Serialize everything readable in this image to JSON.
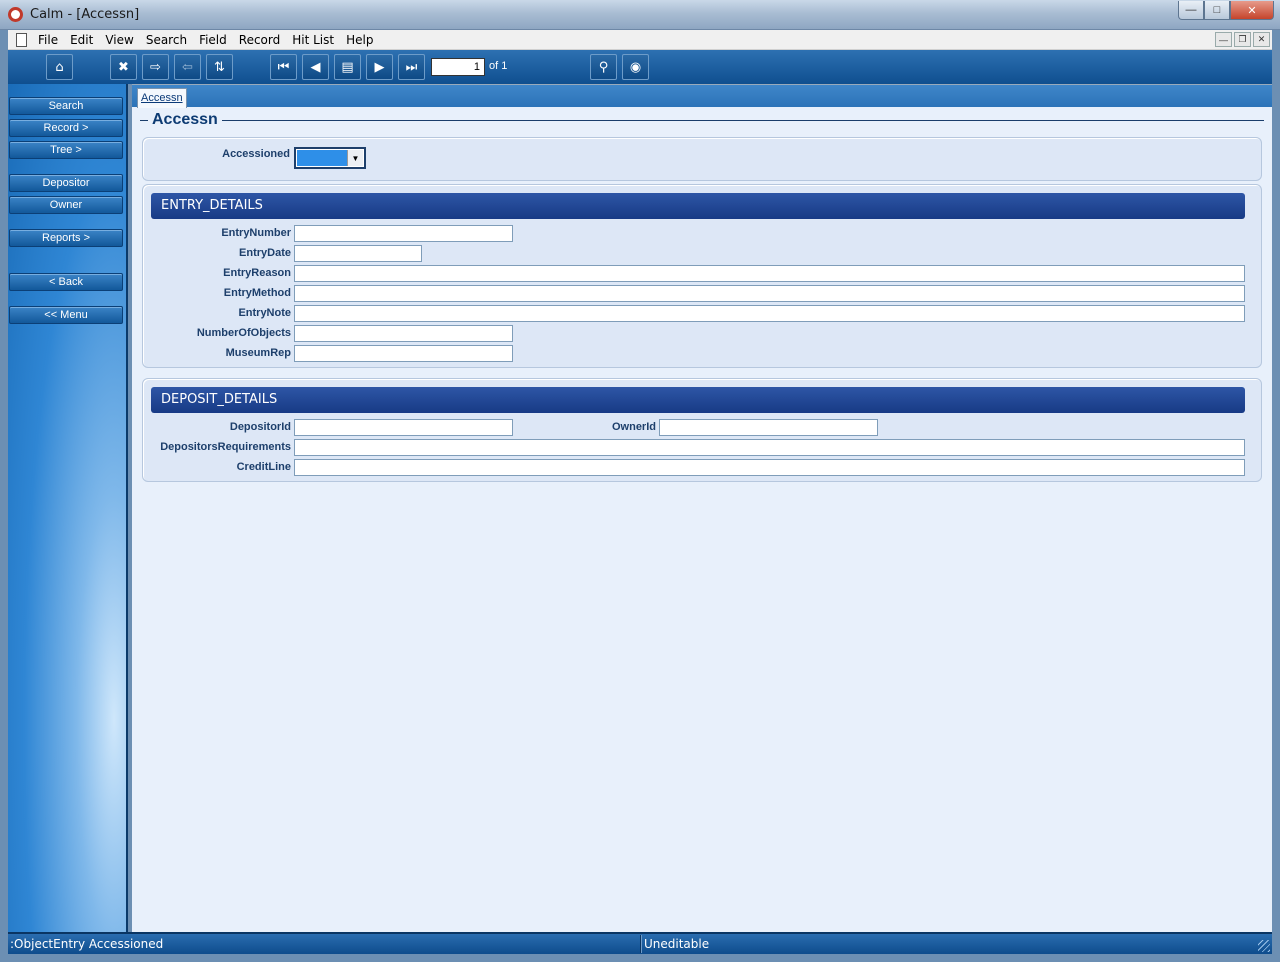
{
  "window": {
    "title": "Calm - [Accessn]"
  },
  "menu": {
    "items": [
      "File",
      "Edit",
      "View",
      "Search",
      "Field",
      "Record",
      "Hit List",
      "Help"
    ]
  },
  "toolbar": {
    "record_number": "1",
    "record_of": "of 1",
    "icons": [
      "home-icon",
      "fullscreen-icon",
      "forward-icon",
      "back-arrow-icon",
      "sort-icon",
      "first-record-icon",
      "previous-record-icon",
      "list-view-icon",
      "next-record-icon",
      "last-record-icon",
      "find-icon",
      "view-icon"
    ]
  },
  "sidebar": {
    "buttons": [
      "Search",
      "Record >",
      "Tree >",
      "Depositor",
      "Owner",
      "Reports >",
      "< Back",
      "<< Menu"
    ]
  },
  "tab": {
    "label": "Accessn"
  },
  "page": {
    "title": "Accessn"
  },
  "accessioned": {
    "label": "Accessioned"
  },
  "entry_details": {
    "heading": "ENTRY_DETAILS",
    "labels": [
      "EntryNumber",
      "EntryDate",
      "EntryReason",
      "EntryMethod",
      "EntryNote",
      "NumberOfObjects",
      "MuseumRep"
    ]
  },
  "deposit_details": {
    "heading": "DEPOSIT_DETAILS",
    "labels": [
      "DepositorId",
      "OwnerId",
      "DepositorsRequirements",
      "CreditLine"
    ]
  },
  "status": {
    "left": ":ObjectEntry Accessioned",
    "right": "Uneditable"
  }
}
